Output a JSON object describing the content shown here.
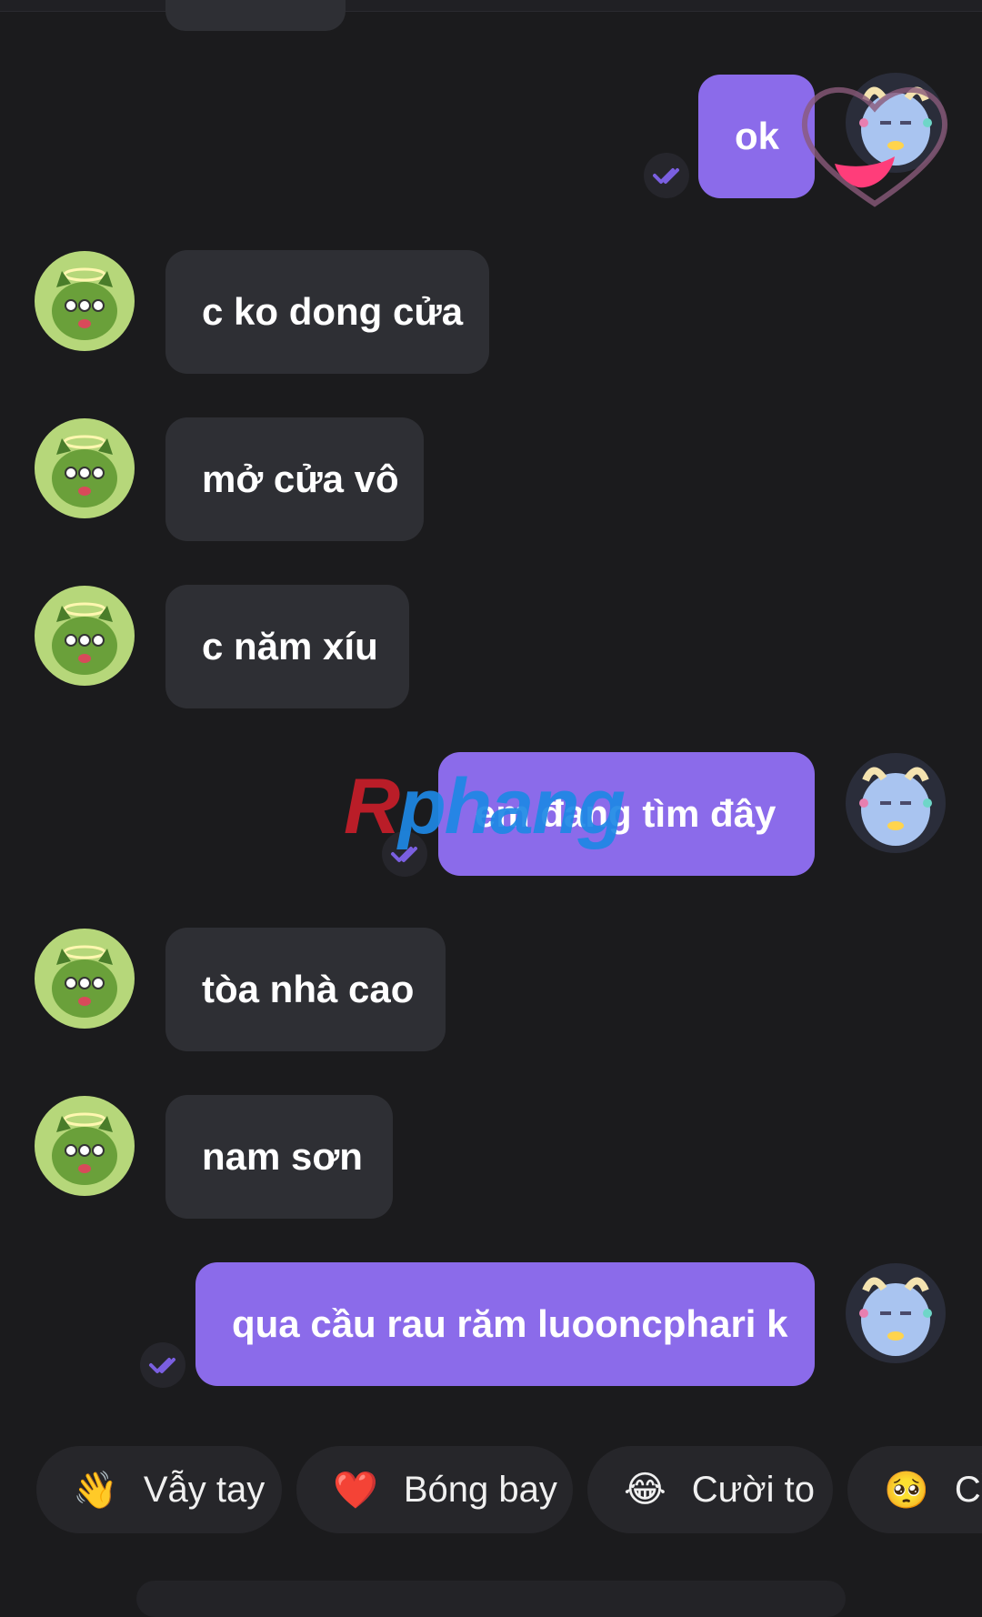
{
  "messages": [
    {
      "id": "m1",
      "side": "out",
      "text": "ok",
      "read": true
    },
    {
      "id": "m2",
      "side": "in",
      "text": "c ko dong cửa"
    },
    {
      "id": "m3",
      "side": "in",
      "text": "mở cửa vô"
    },
    {
      "id": "m4",
      "side": "in",
      "text": "c năm xíu"
    },
    {
      "id": "m5",
      "side": "out",
      "text": "em đang tìm đây",
      "read": true
    },
    {
      "id": "m6",
      "side": "in",
      "text": "tòa nhà cao"
    },
    {
      "id": "m7",
      "side": "in",
      "text": "nam sơn"
    },
    {
      "id": "m8",
      "side": "out",
      "text": "qua cầu rau răm luooncphari k",
      "read": true
    }
  ],
  "watermark": {
    "first": "R",
    "rest": "phang"
  },
  "quick_reactions": [
    {
      "emoji": "👋",
      "label": "Vẫy tay",
      "icon": "waving-hand-icon"
    },
    {
      "emoji": "❤️",
      "label": "Bóng bay",
      "icon": "heart-icon"
    },
    {
      "emoji": "😂",
      "label": "Cười to",
      "icon": "laughing-face-icon"
    },
    {
      "emoji": "🥺",
      "label": "Cầ",
      "icon": "pleading-face-icon"
    }
  ],
  "colors": {
    "background": "#1b1b1d",
    "incoming_bubble": "#2e2f34",
    "outgoing_bubble": "#8b6bea",
    "read_check": "#7a5fe0"
  }
}
